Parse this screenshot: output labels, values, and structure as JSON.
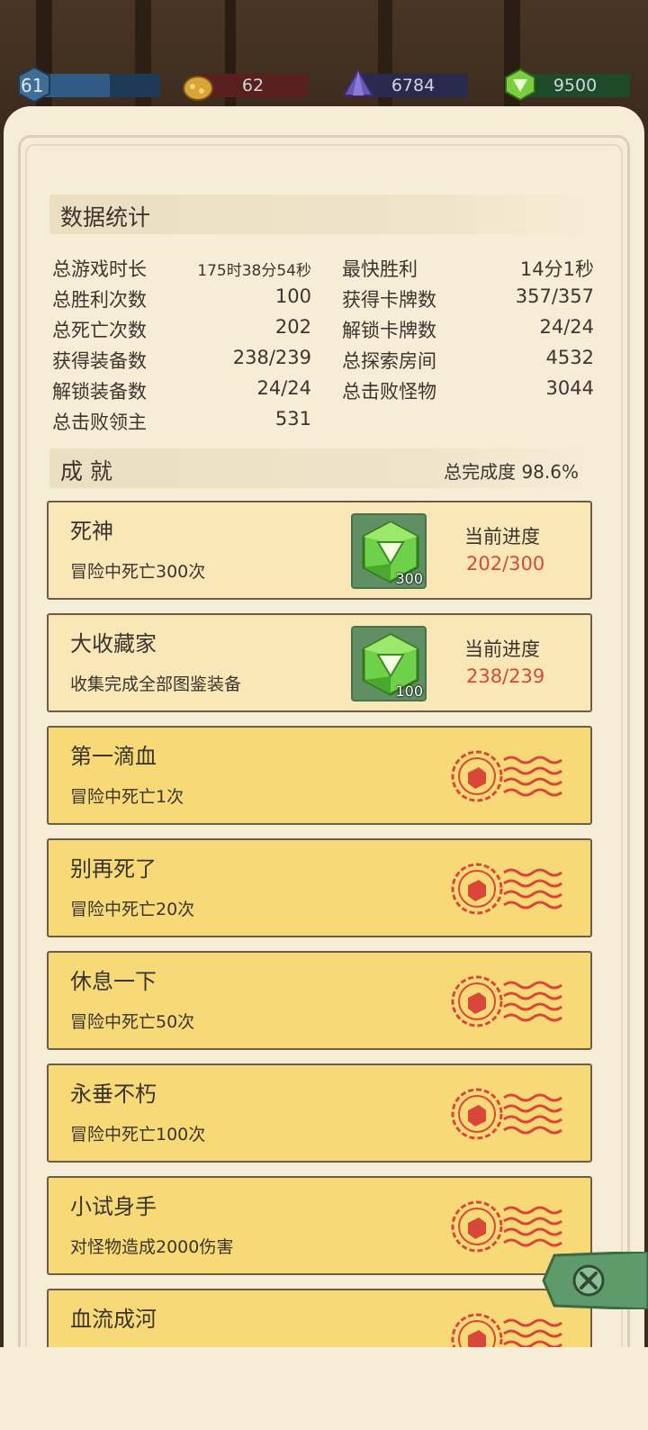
{
  "resources": {
    "level": "61",
    "currency_a": "62",
    "currency_b": "6784",
    "currency_c": "9500"
  },
  "stats": {
    "title": "数据统计",
    "left": [
      {
        "label": "总游戏时长",
        "value": "175时38分54秒"
      },
      {
        "label": "总胜利次数",
        "value": "100"
      },
      {
        "label": "总死亡次数",
        "value": "202"
      },
      {
        "label": "获得装备数",
        "value": "238/239"
      },
      {
        "label": "解锁装备数",
        "value": "24/24"
      },
      {
        "label": "总击败领主",
        "value": "531"
      }
    ],
    "right": [
      {
        "label": "最快胜利",
        "value": "14分1秒"
      },
      {
        "label": "获得卡牌数",
        "value": "357/357"
      },
      {
        "label": "解锁卡牌数",
        "value": "24/24"
      },
      {
        "label": "总探索房间",
        "value": "4532"
      },
      {
        "label": "总击败怪物",
        "value": "3044"
      }
    ]
  },
  "achievements": {
    "title": "成 就",
    "completion_label": "总完成度",
    "completion_value": "98.6%",
    "progress_label": "当前进度",
    "items": [
      {
        "name": "死神",
        "desc": "冒险中死亡300次",
        "status": "incomplete",
        "reward": "300",
        "progress": "202/300"
      },
      {
        "name": "大收藏家",
        "desc": "收集完成全部图鉴装备",
        "status": "incomplete",
        "reward": "100",
        "progress": "238/239"
      },
      {
        "name": "第一滴血",
        "desc": "冒险中死亡1次",
        "status": "complete"
      },
      {
        "name": "别再死了",
        "desc": "冒险中死亡20次",
        "status": "complete"
      },
      {
        "name": "休息一下",
        "desc": "冒险中死亡50次",
        "status": "complete"
      },
      {
        "name": "永垂不朽",
        "desc": "冒险中死亡100次",
        "status": "complete"
      },
      {
        "name": "小试身手",
        "desc": "对怪物造成2000伤害",
        "status": "complete"
      },
      {
        "name": "血流成河",
        "desc": "",
        "status": "complete"
      }
    ]
  },
  "colors": {
    "progress_red": "#d34a3a",
    "card_complete": "#f7d978",
    "card_incomplete": "#f9e7b8",
    "gem_green": "#6fd14a",
    "close_green": "#5f9a6a"
  },
  "icons": {
    "level": "level-shield-icon",
    "currency_a": "gold-pouch-icon",
    "currency_b": "purple-crystal-icon",
    "currency_c": "green-gem-icon",
    "reward": "green-gem-icon",
    "completed": "red-stamp-icon",
    "close": "close-icon"
  }
}
